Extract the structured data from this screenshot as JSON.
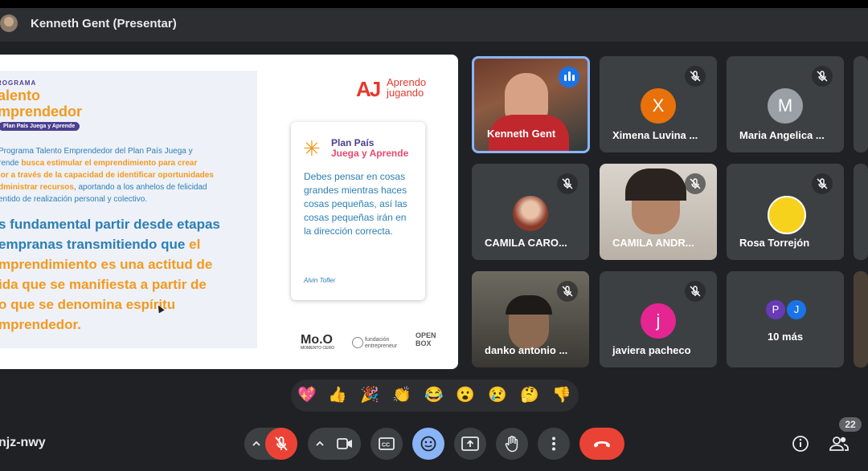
{
  "header": {
    "presenter_title": "Kenneth Gent (Presentar)"
  },
  "slide": {
    "kicker": "ROGRAMA",
    "title_line1": "alento",
    "title_line2": "mprendedor",
    "tag": "Plan País Juega y Aprende",
    "desc_l1": "Programa Talento Emprendedor del Plan País Juega y",
    "desc_l2a": "rende ",
    "desc_l2b": "busca estimular el emprendimiento para crear",
    "desc_l3": "lor a través de la capacidad de identificar oportunidades",
    "desc_l4a": "dministrar recursos",
    "desc_l4b": ", aportando a los anhelos de felicidad",
    "desc_l5": "entido de realización personal y colectivo.",
    "quote_l1": "s fundamental partir desde etapas",
    "quote_l2a": "empranas transmitiendo que ",
    "quote_l2b": "el",
    "quote_l3": "mprendimiento es una actitud de",
    "quote_l4": "ida que se manifiesta a partir de",
    "quote_l5": "o que se denomina espíritu",
    "quote_l6": "mprendedor.",
    "brand_mark": "AJ",
    "brand_line1": "Aprendo",
    "brand_line2": "jugando",
    "card_brand1": "Plan País",
    "card_brand2": "Juega y Aprende",
    "card_text": "Debes pensar en cosas grandes mientras haces cosas pequeñas, así las cosas pequeñas irán en la dirección correcta.",
    "card_author": "Alvin Tofler",
    "sponsor1": "Mo.O",
    "sponsor1_sub": "MOMENTO CERO",
    "sponsor2_l1": "fundación",
    "sponsor2_l2": "entrepreneur",
    "sponsor3_l1": "OPEN",
    "sponsor3_l2": "BOX"
  },
  "participants": [
    {
      "name": "Kenneth Gent"
    },
    {
      "name": "Ximena Luvina ...",
      "initial": "X",
      "color": "#e8710a"
    },
    {
      "name": "Maria Angelica ...",
      "initial": "M",
      "color": "#9aa0a6"
    },
    {
      "name": "CAMILA CARO..."
    },
    {
      "name": "CAMILA ANDR..."
    },
    {
      "name": "Rosa Torrejón"
    },
    {
      "name": "danko antonio ..."
    },
    {
      "name": "javiera pacheco",
      "initial": "j",
      "color": "#e52592"
    },
    {
      "name": "10 más",
      "initials": [
        "P",
        "J"
      ]
    }
  ],
  "reactions": [
    "💖",
    "👍",
    "🎉",
    "👏",
    "😂",
    "😮",
    "😢",
    "🤔",
    "👎"
  ],
  "meeting_code": "njz-nwy",
  "people_count": "22",
  "colors": {
    "accent": "#8ab4f8",
    "danger": "#ea4335",
    "surface": "#3c4043",
    "background": "#202124"
  }
}
